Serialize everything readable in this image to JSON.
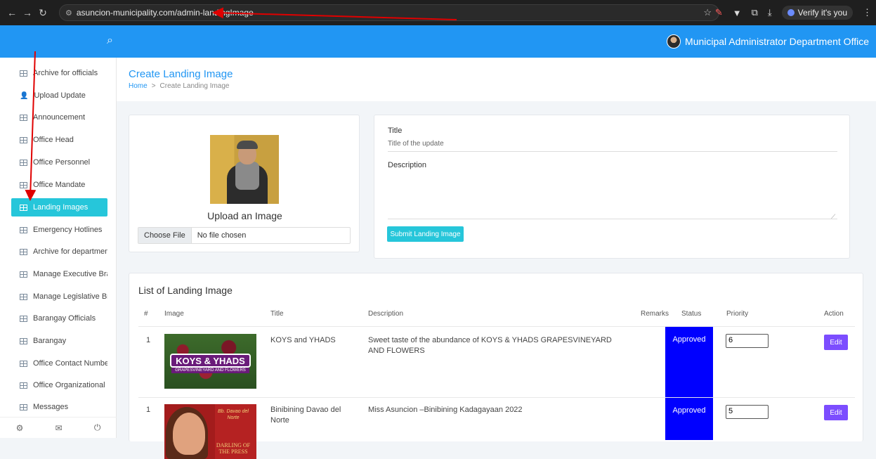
{
  "browser": {
    "url": "asuncion-municipality.com/admin-landingImage",
    "verify_label": "Verify it's you"
  },
  "header": {
    "office_name": "Municipal Administrator Department Office"
  },
  "sidebar": {
    "items": [
      {
        "label": "Archive for officials",
        "icon": "grid-icon"
      },
      {
        "label": "Upload Update",
        "icon": "user-edit-icon"
      },
      {
        "label": "Announcement",
        "icon": "grid-icon"
      },
      {
        "label": "Office Head",
        "icon": "grid-icon"
      },
      {
        "label": "Office Personnel",
        "icon": "grid-icon"
      },
      {
        "label": "Office Mandate",
        "icon": "grid-icon"
      },
      {
        "label": "Landing Images",
        "icon": "grid-icon",
        "active": true
      },
      {
        "label": "Emergency Hotlines",
        "icon": "grid-icon"
      },
      {
        "label": "Archive for department",
        "icon": "grid-icon"
      },
      {
        "label": "Manage Executive Brancl",
        "icon": "grid-icon"
      },
      {
        "label": "Manage Legislative Bran‹",
        "icon": "grid-icon"
      },
      {
        "label": "Barangay Officials",
        "icon": "grid-icon"
      },
      {
        "label": "Barangay",
        "icon": "grid-icon"
      },
      {
        "label": "Office Contact Number",
        "icon": "grid-icon"
      },
      {
        "label": "Office Organizational Cha",
        "icon": "grid-icon"
      },
      {
        "label": "Messages",
        "icon": "grid-icon"
      }
    ]
  },
  "page": {
    "title": "Create Landing Image",
    "breadcrumb_home": "Home",
    "breadcrumb_sep": ">",
    "breadcrumb_current": "Create Landing Image"
  },
  "upload": {
    "label": "Upload an Image",
    "choose_file": "Choose File",
    "no_file": "No file chosen"
  },
  "form": {
    "title_label": "Title",
    "title_placeholder": "Title of the update",
    "description_label": "Description",
    "submit_label": "Submit Landing Image"
  },
  "list": {
    "title": "List of Landing Image",
    "columns": [
      "#",
      "Image",
      "Title",
      "Description",
      "Remarks",
      "Status",
      "Priority",
      "Action"
    ],
    "rows": [
      {
        "num": "1",
        "image_caption": "KOYS & YHADS",
        "image_sub": "GRAPESVINEYARD AND FLOWERS",
        "title": "KOYS and YHADS",
        "description": "Sweet taste of the abundance of KOYS & YHADS GRAPESVINEYARD AND FLOWERS",
        "remarks": "",
        "status": "Approved",
        "priority": "6",
        "action": "Edit"
      },
      {
        "num": "1",
        "image_caption": "Bb. Davao del Norte",
        "image_sub": "DARLING OF THE PRESS",
        "title": "Binibining Davao del Norte",
        "description": "Miss Asuncion –Binibining Kadagayaan 2022",
        "remarks": "",
        "status": "Approved",
        "priority": "5",
        "action": "Edit"
      }
    ]
  },
  "colors": {
    "header": "#2196f3",
    "active_item": "#26c6da",
    "status_bg": "#0000ff",
    "edit_btn": "#7c4dff",
    "annotation": "#e00000"
  }
}
